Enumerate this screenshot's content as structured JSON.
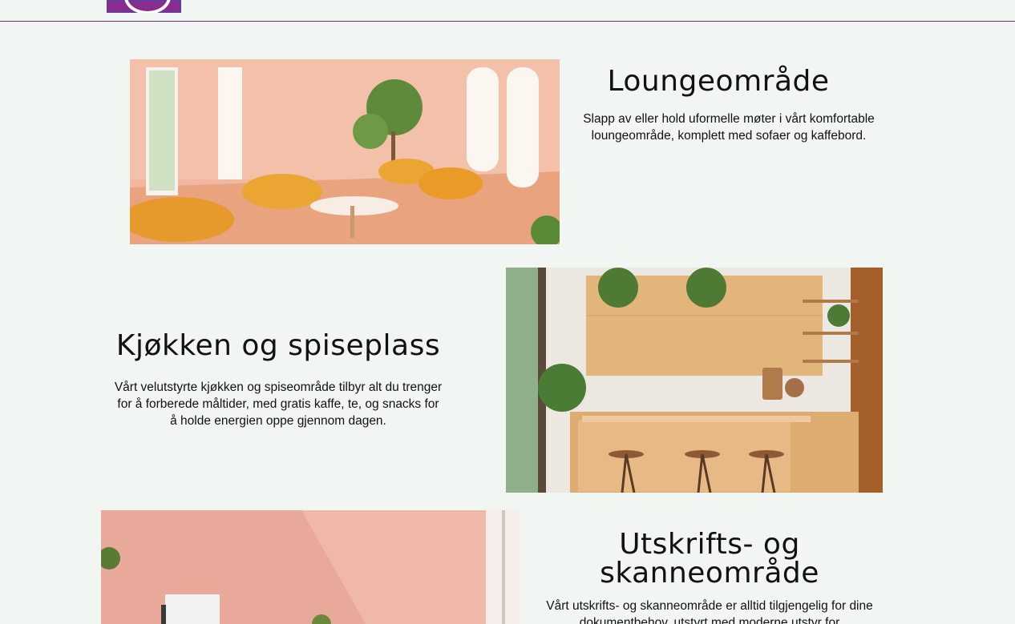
{
  "header": {
    "logo_alt": "logo"
  },
  "sections": [
    {
      "title": "Loungeområde",
      "description": "Slapp av eller hold uformelle møter i vårt komfortable loungeområde, komplett med sofaer og kaffebord."
    },
    {
      "title": "Kjøkken og spiseplass",
      "description": "Vårt velutstyrte kjøkken og spiseområde tilbyr alt du trenger for å forberede måltider, med gratis kaffe, te, og snacks for å holde energien oppe gjennom dagen."
    },
    {
      "title": "Utskrifts- og skanneområde",
      "description": "Vårt utskrifts- og skanneområde er alltid tilgjengelig for dine dokumentbehov, utstyrt med moderne utstyr for"
    }
  ],
  "colors": {
    "background": "#f2f6f3",
    "header_border": "#7a2a82",
    "logo": "#8a2b8e"
  }
}
